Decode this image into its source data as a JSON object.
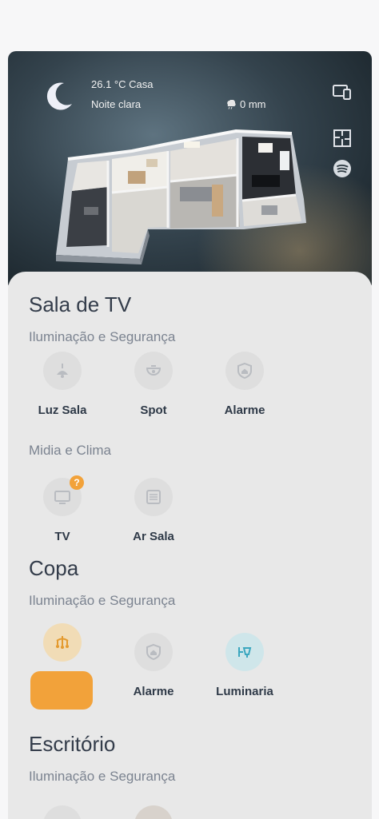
{
  "hero": {
    "weather_temp": "26.1 °C Casa",
    "weather_desc": "Noite clara",
    "rain": "0 mm",
    "icons": [
      "moon-icon",
      "rain-cloud-icon",
      "devices-icon",
      "floorplan-icon",
      "spotify-icon"
    ]
  },
  "rooms": [
    {
      "title": "Sala de TV",
      "sections": [
        {
          "label": "Iluminação e Segurança",
          "devices": [
            {
              "label": "Luz Sala",
              "icon": "ceiling-lamp-icon"
            },
            {
              "label": "Spot",
              "icon": "spot-light-icon"
            },
            {
              "label": "Alarme",
              "icon": "shield-home-icon"
            }
          ]
        },
        {
          "label": "Midia e Clima",
          "devices": [
            {
              "label": "TV",
              "icon": "tv-icon",
              "badge": "?"
            },
            {
              "label": "Ar Sala",
              "icon": "air-conditioner-icon"
            }
          ]
        }
      ]
    },
    {
      "title": "Copa",
      "sections": [
        {
          "label": "Iluminação e Segurança",
          "devices": [
            {
              "label": "",
              "icon": "chandelier-icon"
            },
            {
              "label": "Alarme",
              "icon": "shield-home-icon"
            },
            {
              "label": "Luminaria",
              "icon": "wall-lamp-icon"
            }
          ]
        }
      ]
    },
    {
      "title": "Escritório",
      "sections": [
        {
          "label": "Iluminação e Segurança",
          "devices": []
        }
      ]
    }
  ],
  "colors": {
    "accent_orange": "#f2a23a",
    "active_blue": "#cfe6ea",
    "text_dark": "#2f3a48",
    "text_muted": "#7b8390"
  }
}
